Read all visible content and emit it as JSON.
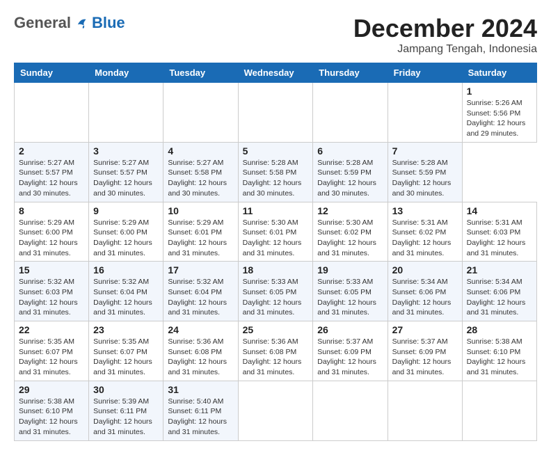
{
  "header": {
    "logo_general": "General",
    "logo_blue": "Blue",
    "main_title": "December 2024",
    "subtitle": "Jampang Tengah, Indonesia"
  },
  "calendar": {
    "days_of_week": [
      "Sunday",
      "Monday",
      "Tuesday",
      "Wednesday",
      "Thursday",
      "Friday",
      "Saturday"
    ],
    "weeks": [
      [
        null,
        null,
        null,
        null,
        null,
        null,
        {
          "day": "1",
          "sunrise": "Sunrise: 5:26 AM",
          "sunset": "Sunset: 5:56 PM",
          "daylight": "Daylight: 12 hours",
          "daylight2": "and 29 minutes."
        }
      ],
      [
        {
          "day": "2",
          "sunrise": "Sunrise: 5:27 AM",
          "sunset": "Sunset: 5:57 PM",
          "daylight": "Daylight: 12 hours",
          "daylight2": "and 30 minutes."
        },
        {
          "day": "3",
          "sunrise": "Sunrise: 5:27 AM",
          "sunset": "Sunset: 5:57 PM",
          "daylight": "Daylight: 12 hours",
          "daylight2": "and 30 minutes."
        },
        {
          "day": "4",
          "sunrise": "Sunrise: 5:27 AM",
          "sunset": "Sunset: 5:58 PM",
          "daylight": "Daylight: 12 hours",
          "daylight2": "and 30 minutes."
        },
        {
          "day": "5",
          "sunrise": "Sunrise: 5:28 AM",
          "sunset": "Sunset: 5:58 PM",
          "daylight": "Daylight: 12 hours",
          "daylight2": "and 30 minutes."
        },
        {
          "day": "6",
          "sunrise": "Sunrise: 5:28 AM",
          "sunset": "Sunset: 5:59 PM",
          "daylight": "Daylight: 12 hours",
          "daylight2": "and 30 minutes."
        },
        {
          "day": "7",
          "sunrise": "Sunrise: 5:28 AM",
          "sunset": "Sunset: 5:59 PM",
          "daylight": "Daylight: 12 hours",
          "daylight2": "and 30 minutes."
        }
      ],
      [
        {
          "day": "8",
          "sunrise": "Sunrise: 5:29 AM",
          "sunset": "Sunset: 6:00 PM",
          "daylight": "Daylight: 12 hours",
          "daylight2": "and 31 minutes."
        },
        {
          "day": "9",
          "sunrise": "Sunrise: 5:29 AM",
          "sunset": "Sunset: 6:00 PM",
          "daylight": "Daylight: 12 hours",
          "daylight2": "and 31 minutes."
        },
        {
          "day": "10",
          "sunrise": "Sunrise: 5:29 AM",
          "sunset": "Sunset: 6:01 PM",
          "daylight": "Daylight: 12 hours",
          "daylight2": "and 31 minutes."
        },
        {
          "day": "11",
          "sunrise": "Sunrise: 5:30 AM",
          "sunset": "Sunset: 6:01 PM",
          "daylight": "Daylight: 12 hours",
          "daylight2": "and 31 minutes."
        },
        {
          "day": "12",
          "sunrise": "Sunrise: 5:30 AM",
          "sunset": "Sunset: 6:02 PM",
          "daylight": "Daylight: 12 hours",
          "daylight2": "and 31 minutes."
        },
        {
          "day": "13",
          "sunrise": "Sunrise: 5:31 AM",
          "sunset": "Sunset: 6:02 PM",
          "daylight": "Daylight: 12 hours",
          "daylight2": "and 31 minutes."
        },
        {
          "day": "14",
          "sunrise": "Sunrise: 5:31 AM",
          "sunset": "Sunset: 6:03 PM",
          "daylight": "Daylight: 12 hours",
          "daylight2": "and 31 minutes."
        }
      ],
      [
        {
          "day": "15",
          "sunrise": "Sunrise: 5:32 AM",
          "sunset": "Sunset: 6:03 PM",
          "daylight": "Daylight: 12 hours",
          "daylight2": "and 31 minutes."
        },
        {
          "day": "16",
          "sunrise": "Sunrise: 5:32 AM",
          "sunset": "Sunset: 6:04 PM",
          "daylight": "Daylight: 12 hours",
          "daylight2": "and 31 minutes."
        },
        {
          "day": "17",
          "sunrise": "Sunrise: 5:32 AM",
          "sunset": "Sunset: 6:04 PM",
          "daylight": "Daylight: 12 hours",
          "daylight2": "and 31 minutes."
        },
        {
          "day": "18",
          "sunrise": "Sunrise: 5:33 AM",
          "sunset": "Sunset: 6:05 PM",
          "daylight": "Daylight: 12 hours",
          "daylight2": "and 31 minutes."
        },
        {
          "day": "19",
          "sunrise": "Sunrise: 5:33 AM",
          "sunset": "Sunset: 6:05 PM",
          "daylight": "Daylight: 12 hours",
          "daylight2": "and 31 minutes."
        },
        {
          "day": "20",
          "sunrise": "Sunrise: 5:34 AM",
          "sunset": "Sunset: 6:06 PM",
          "daylight": "Daylight: 12 hours",
          "daylight2": "and 31 minutes."
        },
        {
          "day": "21",
          "sunrise": "Sunrise: 5:34 AM",
          "sunset": "Sunset: 6:06 PM",
          "daylight": "Daylight: 12 hours",
          "daylight2": "and 31 minutes."
        }
      ],
      [
        {
          "day": "22",
          "sunrise": "Sunrise: 5:35 AM",
          "sunset": "Sunset: 6:07 PM",
          "daylight": "Daylight: 12 hours",
          "daylight2": "and 31 minutes."
        },
        {
          "day": "23",
          "sunrise": "Sunrise: 5:35 AM",
          "sunset": "Sunset: 6:07 PM",
          "daylight": "Daylight: 12 hours",
          "daylight2": "and 31 minutes."
        },
        {
          "day": "24",
          "sunrise": "Sunrise: 5:36 AM",
          "sunset": "Sunset: 6:08 PM",
          "daylight": "Daylight: 12 hours",
          "daylight2": "and 31 minutes."
        },
        {
          "day": "25",
          "sunrise": "Sunrise: 5:36 AM",
          "sunset": "Sunset: 6:08 PM",
          "daylight": "Daylight: 12 hours",
          "daylight2": "and 31 minutes."
        },
        {
          "day": "26",
          "sunrise": "Sunrise: 5:37 AM",
          "sunset": "Sunset: 6:09 PM",
          "daylight": "Daylight: 12 hours",
          "daylight2": "and 31 minutes."
        },
        {
          "day": "27",
          "sunrise": "Sunrise: 5:37 AM",
          "sunset": "Sunset: 6:09 PM",
          "daylight": "Daylight: 12 hours",
          "daylight2": "and 31 minutes."
        },
        {
          "day": "28",
          "sunrise": "Sunrise: 5:38 AM",
          "sunset": "Sunset: 6:10 PM",
          "daylight": "Daylight: 12 hours",
          "daylight2": "and 31 minutes."
        }
      ],
      [
        {
          "day": "29",
          "sunrise": "Sunrise: 5:38 AM",
          "sunset": "Sunset: 6:10 PM",
          "daylight": "Daylight: 12 hours",
          "daylight2": "and 31 minutes."
        },
        {
          "day": "30",
          "sunrise": "Sunrise: 5:39 AM",
          "sunset": "Sunset: 6:11 PM",
          "daylight": "Daylight: 12 hours",
          "daylight2": "and 31 minutes."
        },
        {
          "day": "31",
          "sunrise": "Sunrise: 5:40 AM",
          "sunset": "Sunset: 6:11 PM",
          "daylight": "Daylight: 12 hours",
          "daylight2": "and 31 minutes."
        },
        null,
        null,
        null,
        null
      ]
    ]
  }
}
